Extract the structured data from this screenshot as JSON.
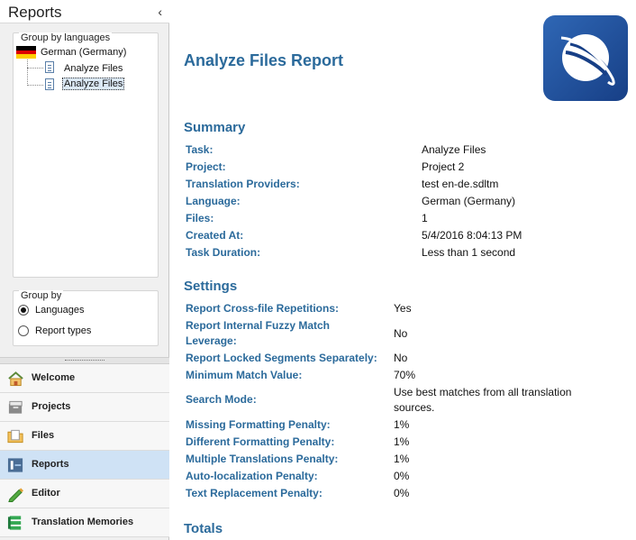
{
  "left_panel": {
    "title": "Reports",
    "collapse_glyph": "‹",
    "group_by_languages_label": "Group by languages",
    "tree": {
      "language": "German (Germany)",
      "items": [
        "Analyze Files",
        "Analyze Files"
      ]
    },
    "group_by": {
      "label": "Group by",
      "options": [
        "Languages",
        "Report types"
      ],
      "selected": "Languages"
    },
    "nav": [
      {
        "label": "Welcome",
        "icon": "home-icon"
      },
      {
        "label": "Projects",
        "icon": "projects-icon"
      },
      {
        "label": "Files",
        "icon": "files-icon"
      },
      {
        "label": "Reports",
        "icon": "reports-icon",
        "active": true
      },
      {
        "label": "Editor",
        "icon": "editor-icon"
      },
      {
        "label": "Translation Memories",
        "icon": "translation-memories-icon"
      }
    ]
  },
  "report": {
    "title": "Analyze Files Report",
    "summary": {
      "heading": "Summary",
      "rows": [
        {
          "label": "Task:",
          "value": "Analyze Files"
        },
        {
          "label": "Project:",
          "value": "Project 2"
        },
        {
          "label": "Translation Providers:",
          "value": "test en-de.sdltm"
        },
        {
          "label": "Language:",
          "value": "German (Germany)"
        },
        {
          "label": "Files:",
          "value": "1"
        },
        {
          "label": "Created At:",
          "value": "5/4/2016 8:04:13 PM"
        },
        {
          "label": "Task Duration:",
          "value": "Less than 1 second"
        }
      ]
    },
    "settings": {
      "heading": "Settings",
      "rows": [
        {
          "label": "Report Cross-file Repetitions:",
          "value": "Yes"
        },
        {
          "label": "Report Internal Fuzzy Match",
          "label2": "Leverage:",
          "value": "No"
        },
        {
          "label": "Report Locked Segments Separately:",
          "value": "No"
        },
        {
          "label": "Minimum Match Value:",
          "value": "70%"
        },
        {
          "label": "Search Mode:",
          "value": "Use best matches from all translation",
          "value2": "sources."
        },
        {
          "label": "Missing Formatting Penalty:",
          "value": "1%"
        },
        {
          "label": "Different Formatting Penalty:",
          "value": "1%"
        },
        {
          "label": "Multiple Translations Penalty:",
          "value": "1%"
        },
        {
          "label": "Auto-localization Penalty:",
          "value": "0%"
        },
        {
          "label": "Text Replacement Penalty:",
          "value": "0%"
        }
      ]
    },
    "totals": {
      "heading": "Totals"
    }
  },
  "colors": {
    "accent": "#2b6a9b",
    "active_nav": "#cfe2f5",
    "logo": "#245aa8"
  }
}
